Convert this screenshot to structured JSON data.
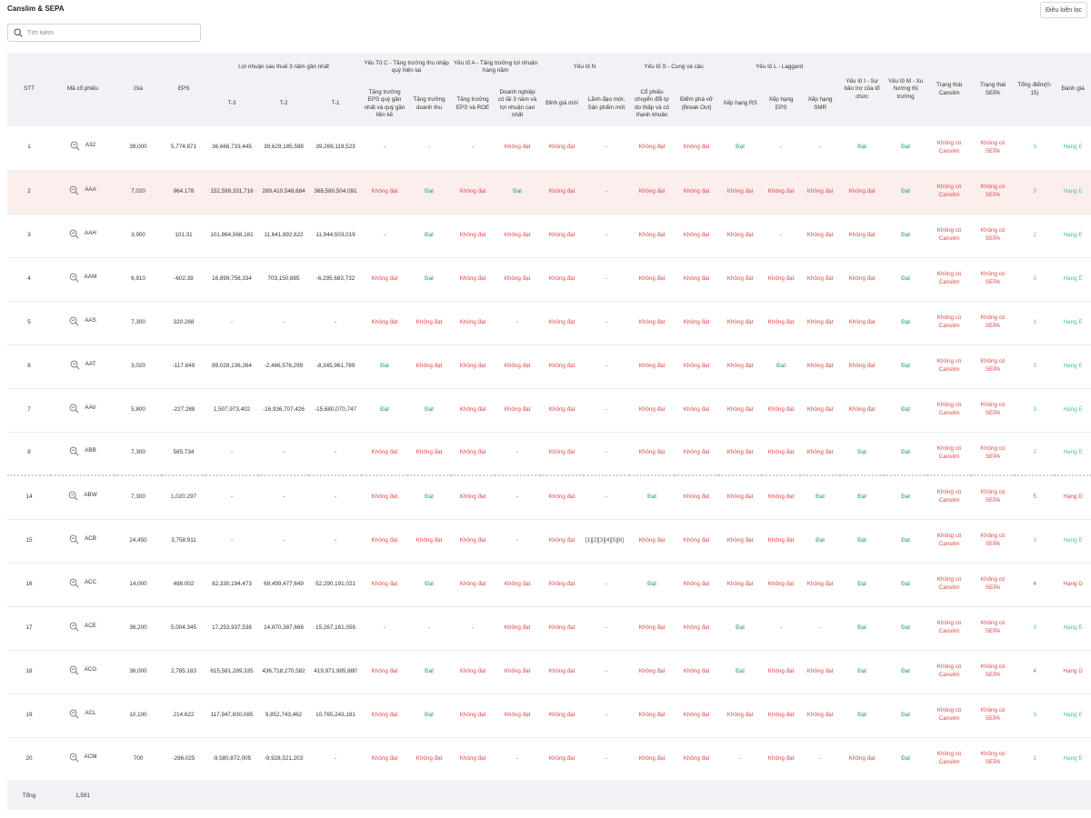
{
  "header": {
    "title": "Canslim & SEPA",
    "filter_button": "Điều kiện lọc"
  },
  "search": {
    "placeholder": "Tìm kiếm"
  },
  "table": {
    "columns": {
      "stt": "STT",
      "symbol": "Mã cổ phiếu",
      "price": "Giá",
      "eps": "EPS",
      "profit_group": "Lợi nhuận sau thuế 3 năm gần nhất",
      "t3": "T-3",
      "t2": "T-2",
      "t1": "T-1",
      "c_group": "Yếu Tố C - Tăng trưởng thu nhập quý hiện tại",
      "c1": "Tăng trưởng EPS quý gần nhất và quý gần liền kề",
      "c2": "Tăng trưởng doanh thu",
      "a_group": "Yếu tố A - Tăng trưởng lợi nhuận hàng năm",
      "a1": "Tăng trưởng EPS và ROE",
      "a2": "Doanh nghiệp có lãi 3 năm và lợi nhuận cao nhất",
      "n_group": "Yếu tố N",
      "n1": "Đỉnh giá mới",
      "n2": "Lãnh đạo mới, Sản phẩm mới",
      "s_group": "Yếu tố S - Cung và cầu",
      "s1": "Cổ phiếu chuyển đổi tự do thấp và có thanh khoản",
      "s2": "Điểm phá vỡ (Break Out)",
      "l_group": "Yếu tố L - Laggard",
      "l1": "Xếp hạng RS",
      "l2": "Xếp hạng EPS",
      "l3": "Xếp hạng SMR",
      "i_factor": "Yếu tố I - Sự bảo trợ của tổ chức",
      "m_factor": "Yếu tố M - Xu hướng thị trường",
      "canslim_status": "Trạng thái Canslim",
      "sepa_status": "Trạng thái SEPA",
      "total_points": "Tổng điểm(0-15)",
      "rating": "Đánh giá"
    },
    "rows": [
      {
        "stt": "1",
        "sym": "A32",
        "price": "39,000",
        "eps": "5,774.871",
        "t3": "36,666,733,445",
        "t2": "39,629,185,588",
        "t1": "39,269,119,523",
        "c1": "-",
        "c2": "-",
        "a1": "-",
        "a2": "Không đạt",
        "n1": "Không đạt",
        "n2": "-",
        "s1": "Không đạt",
        "s2": "Không đạt",
        "l1": "Đạt",
        "l2": "-",
        "l3": "-",
        "i": "Đạt",
        "m": "Đạt",
        "canslim": "Không có Canslim",
        "sepa": "Không có SEPA",
        "pts": "3",
        "grade": "Hạng E"
      },
      {
        "stt": "2",
        "sym": "AAA",
        "price": "7,020",
        "eps": "964.178",
        "t3": "152,599,331,716",
        "t2": "289,410,548,684",
        "t1": "368,580,504,091",
        "c1": "Không đạt",
        "c2": "Đạt",
        "a1": "Không đạt",
        "a2": "Đạt",
        "n1": "Không đạt",
        "n2": "-",
        "s1": "Không đạt",
        "s2": "Không đạt",
        "l1": "Không đạt",
        "l2": "Không đạt",
        "l3": "Không đạt",
        "i": "Không đạt",
        "m": "Đạt",
        "canslim": "Không có Canslim",
        "sepa": "Không có SEPA",
        "pts": "3",
        "grade": "Hạng E"
      },
      {
        "stt": "3",
        "sym": "AAH",
        "price": "3,900",
        "eps": "101.31",
        "t3": "101,864,568,181",
        "t2": "11,641,892,622",
        "t1": "11,944,503,019",
        "c1": "-",
        "c2": "Đạt",
        "a1": "Không đạt",
        "a2": "Không đạt",
        "n1": "Không đạt",
        "n2": "-",
        "s1": "Không đạt",
        "s2": "Không đạt",
        "l1": "Không đạt",
        "l2": "-",
        "l3": "Không đạt",
        "i": "Không đạt",
        "m": "Đạt",
        "canslim": "Không có Canslim",
        "sepa": "Không có SEPA",
        "pts": "2",
        "grade": "Hạng E"
      },
      {
        "stt": "4",
        "sym": "AAM",
        "price": "6,910",
        "eps": "-602.39",
        "t3": "16,899,756,334",
        "t2": "703,150,885",
        "t1": "-6,295,683,732",
        "c1": "Không đạt",
        "c2": "Đạt",
        "a1": "Không đạt",
        "a2": "Không đạt",
        "n1": "Không đạt",
        "n2": "-",
        "s1": "Không đạt",
        "s2": "Không đạt",
        "l1": "Không đạt",
        "l2": "Không đạt",
        "l3": "Không đạt",
        "i": "Không đạt",
        "m": "Đạt",
        "canslim": "Không có Canslim",
        "sepa": "Không có SEPA",
        "pts": "3",
        "grade": "Hạng E"
      },
      {
        "stt": "5",
        "sym": "AAS",
        "price": "7,300",
        "eps": "320.268",
        "t3": "-",
        "t2": "-",
        "t1": "-",
        "c1": "Không đạt",
        "c2": "Không đạt",
        "a1": "Không đạt",
        "a2": "-",
        "n1": "Không đạt",
        "n2": "-",
        "s1": "Không đạt",
        "s2": "Không đạt",
        "l1": "Không đạt",
        "l2": "Không đạt",
        "l3": "Không đạt",
        "i": "Không đạt",
        "m": "Đạt",
        "canslim": "Không có Canslim",
        "sepa": "Không có SEPA",
        "pts": "1",
        "grade": "Hạng E"
      },
      {
        "stt": "6",
        "sym": "AAT",
        "price": "3,020",
        "eps": "-117.849",
        "t3": "89,028,136,264",
        "t2": "-2,466,576,299",
        "t1": "-8,345,961,789",
        "c1": "Đạt",
        "c2": "Không đạt",
        "a1": "Không đạt",
        "a2": "Không đạt",
        "n1": "Không đạt",
        "n2": "-",
        "s1": "Không đạt",
        "s2": "Không đạt",
        "l1": "Không đạt",
        "l2": "Đạt",
        "l3": "Không đạt",
        "i": "Không đạt",
        "m": "Đạt",
        "canslim": "Không có Canslim",
        "sepa": "Không có SEPA",
        "pts": "3",
        "grade": "Hạng E"
      },
      {
        "stt": "7",
        "sym": "AAV",
        "price": "5,800",
        "eps": "-227.288",
        "t3": "1,507,973,402",
        "t2": "-16,936,707,426",
        "t1": "-15,680,070,747",
        "c1": "Đạt",
        "c2": "Đạt",
        "a1": "Không đạt",
        "a2": "Không đạt",
        "n1": "Không đạt",
        "n2": "-",
        "s1": "Không đạt",
        "s2": "Không đạt",
        "l1": "Không đạt",
        "l2": "Không đạt",
        "l3": "Không đạt",
        "i": "Không đạt",
        "m": "Đạt",
        "canslim": "Không có Canslim",
        "sepa": "Không có SEPA",
        "pts": "3",
        "grade": "Hạng E"
      },
      {
        "stt": "8",
        "sym": "ABB",
        "price": "7,300",
        "eps": "565.734",
        "t3": "-",
        "t2": "-",
        "t1": "-",
        "c1": "Không đạt",
        "c2": "Không đạt",
        "a1": "Không đạt",
        "a2": "-",
        "n1": "Không đạt",
        "n2": "-",
        "s1": "Không đạt",
        "s2": "Không đạt",
        "l1": "Không đạt",
        "l2": "Không đạt",
        "l3": "Không đạt",
        "i": "Đạt",
        "m": "Đạt",
        "canslim": "Không có Canslim",
        "sepa": "Không có SEPA",
        "pts": "2",
        "grade": "Hạng E"
      },
      {
        "stt": "14",
        "sym": "ABW",
        "price": "7,300",
        "eps": "1,020.297",
        "t3": "-",
        "t2": "-",
        "t1": "-",
        "c1": "Không đạt",
        "c2": "Đạt",
        "a1": "Không đạt",
        "a2": "-",
        "n1": "Không đạt",
        "n2": "-",
        "s1": "Đạt",
        "s2": "Không đạt",
        "l1": "Không đạt",
        "l2": "Không đạt",
        "l3": "Đạt",
        "i": "Đạt",
        "m": "Đạt",
        "canslim": "Không có Canslim",
        "sepa": "Không có SEPA",
        "pts": "5",
        "grade": "Hạng D"
      },
      {
        "stt": "15",
        "sym": "ACB",
        "price": "24,450",
        "eps": "3,758.911",
        "t3": "-",
        "t2": "-",
        "t1": "-",
        "c1": "Không đạt",
        "c2": "Không đạt",
        "a1": "Không đạt",
        "a2": "-",
        "n1": "Không đạt",
        "n2": "[1][2][3][4][5][6]",
        "s1": "Không đạt",
        "s2": "Không đạt",
        "l1": "Không đạt",
        "l2": "Không đạt",
        "l3": "Đạt",
        "i": "Đạt",
        "m": "Đạt",
        "canslim": "Không có Canslim",
        "sepa": "Không có SEPA",
        "pts": "3",
        "grade": "Hạng E"
      },
      {
        "stt": "16",
        "sym": "ACC",
        "price": "14,000",
        "eps": "498.002",
        "t3": "82,330,194,473",
        "t2": "69,499,477,649",
        "t1": "52,290,191,021",
        "c1": "Không đạt",
        "c2": "Đạt",
        "a1": "Không đạt",
        "a2": "Không đạt",
        "n1": "Không đạt",
        "n2": "-",
        "s1": "Đạt",
        "s2": "Không đạt",
        "l1": "Không đạt",
        "l2": "Không đạt",
        "l3": "Không đạt",
        "i": "Đạt",
        "m": "Đạt",
        "canslim": "Không có Canslim",
        "sepa": "Không có SEPA",
        "pts": "4",
        "grade": "Hạng D"
      },
      {
        "stt": "17",
        "sym": "ACE",
        "price": "36,200",
        "eps": "5,004.345",
        "t3": "17,253,937,538",
        "t2": "14,870,387,668",
        "t1": "15,267,161,058",
        "c1": "-",
        "c2": "-",
        "a1": "-",
        "a2": "Không đạt",
        "n1": "Không đạt",
        "n2": "-",
        "s1": "Không đạt",
        "s2": "Không đạt",
        "l1": "Đạt",
        "l2": "-",
        "l3": "-",
        "i": "Đạt",
        "m": "Đạt",
        "canslim": "Không có Canslim",
        "sepa": "Không có SEPA",
        "pts": "3",
        "grade": "Hạng E"
      },
      {
        "stt": "18",
        "sym": "ACG",
        "price": "36,000",
        "eps": "2,785.183",
        "t3": "615,581,289,335",
        "t2": "436,718,270,582",
        "t1": "419,971,985,880",
        "c1": "Không đạt",
        "c2": "Đạt",
        "a1": "Không đạt",
        "a2": "Không đạt",
        "n1": "Không đạt",
        "n2": "-",
        "s1": "Không đạt",
        "s2": "Không đạt",
        "l1": "Đạt",
        "l2": "Không đạt",
        "l3": "Không đạt",
        "i": "Đạt",
        "m": "Đạt",
        "canslim": "Không có Canslim",
        "sepa": "Không có SEPA",
        "pts": "4",
        "grade": "Hạng D"
      },
      {
        "stt": "19",
        "sym": "ACL",
        "price": "10,100",
        "eps": "214.622",
        "t3": "117,947,830,085",
        "t2": "9,852,743,462",
        "t1": "10,765,243,181",
        "c1": "Không đạt",
        "c2": "Đạt",
        "a1": "Không đạt",
        "a2": "Không đạt",
        "n1": "Không đạt",
        "n2": "-",
        "s1": "Không đạt",
        "s2": "Không đạt",
        "l1": "Không đạt",
        "l2": "Không đạt",
        "l3": "Không đạt",
        "i": "Đạt",
        "m": "Đạt",
        "canslim": "Không có Canslim",
        "sepa": "Không có SEPA",
        "pts": "3",
        "grade": "Hạng E"
      },
      {
        "stt": "20",
        "sym": "ACM",
        "price": "700",
        "eps": "-296.025",
        "t3": "-9,580,872,005",
        "t2": "-9,928,521,203",
        "t1": "-",
        "c1": "Không đạt",
        "c2": "Không đạt",
        "a1": "Không đạt",
        "a2": "-",
        "n1": "Không đạt",
        "n2": "-",
        "s1": "Không đạt",
        "s2": "Không đạt",
        "l1": "-",
        "l2": "Không đạt",
        "l3": "-",
        "i": "Không đạt",
        "m": "Đạt",
        "canslim": "Không có Canslim",
        "sepa": "Không có SEPA",
        "pts": "1",
        "grade": "Hạng E"
      }
    ],
    "footer": {
      "label": "Tổng",
      "value": "1,591"
    }
  },
  "colors": {
    "pass": "#18a05a",
    "fail": "#e04646",
    "grade_e": "#3fbfa8",
    "grade_d": "#e04646",
    "header_bg": "#f1f2f5",
    "selected_row_bg": "#fdeeee"
  }
}
